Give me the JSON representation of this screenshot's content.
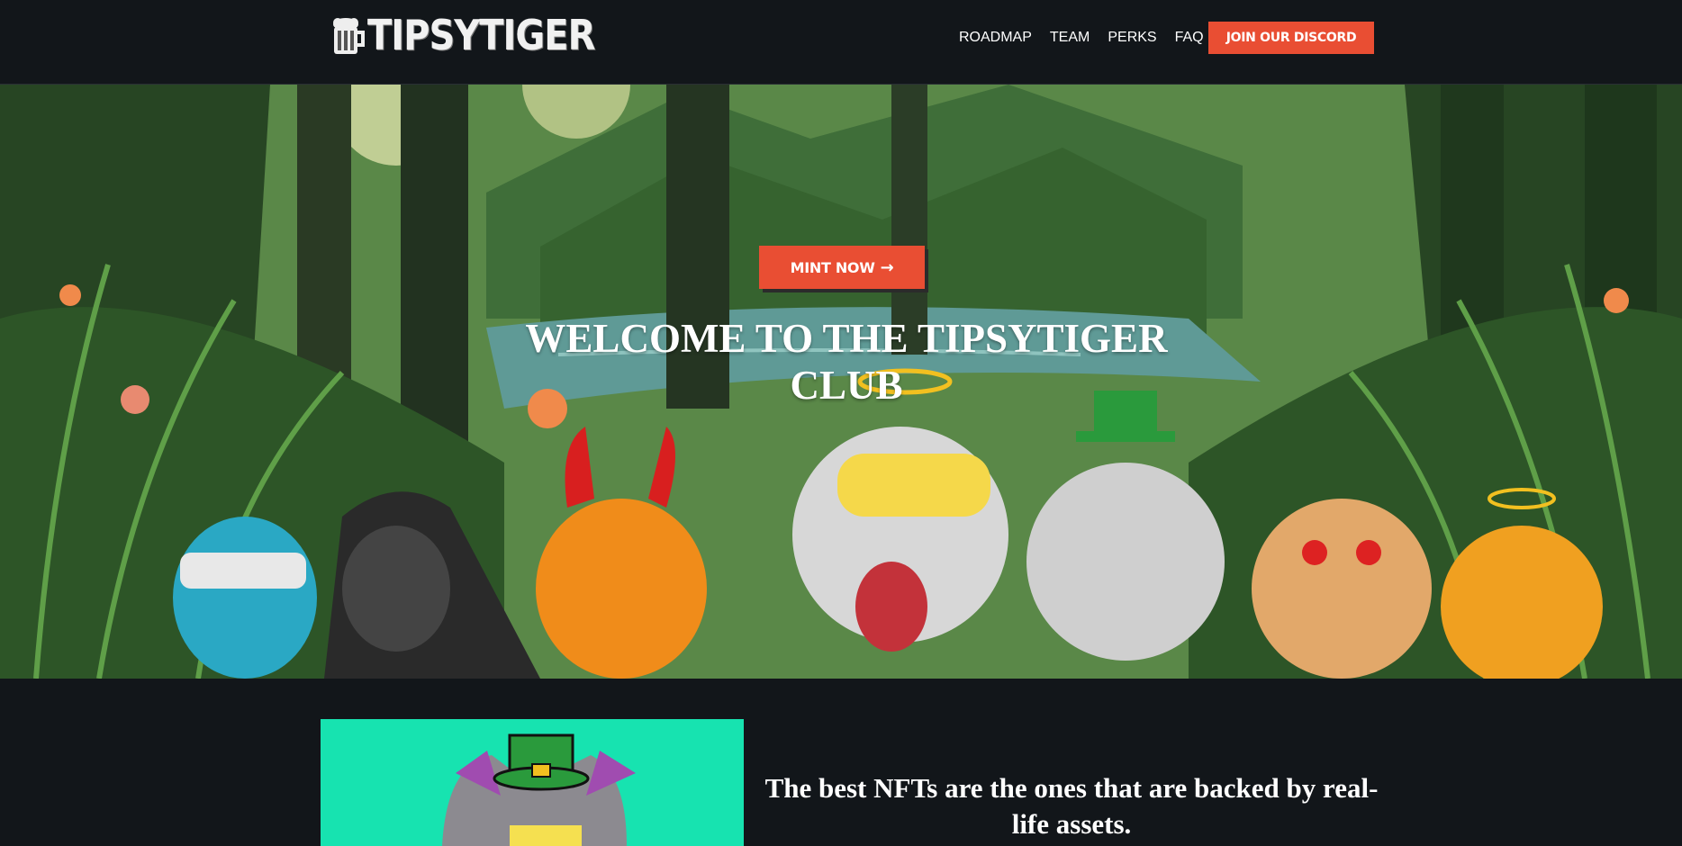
{
  "brand": {
    "logo_text": "TIPSYTIGER"
  },
  "nav": {
    "links": [
      "ROADMAP",
      "TEAM",
      "PERKS",
      "FAQ"
    ],
    "cta_label": "JOIN OUR DISCORD"
  },
  "hero": {
    "mint_label": "MINT NOW",
    "mint_icon": "arrow-right-icon",
    "title": "WELCOME TO THE TIPSYTIGER CLUB"
  },
  "feature": {
    "tagline": "The best NFTs are the ones that are backed by real-life assets."
  },
  "colors": {
    "background": "#12161a",
    "accent": "#e94e33",
    "feature_bg": "#17e3b0"
  }
}
